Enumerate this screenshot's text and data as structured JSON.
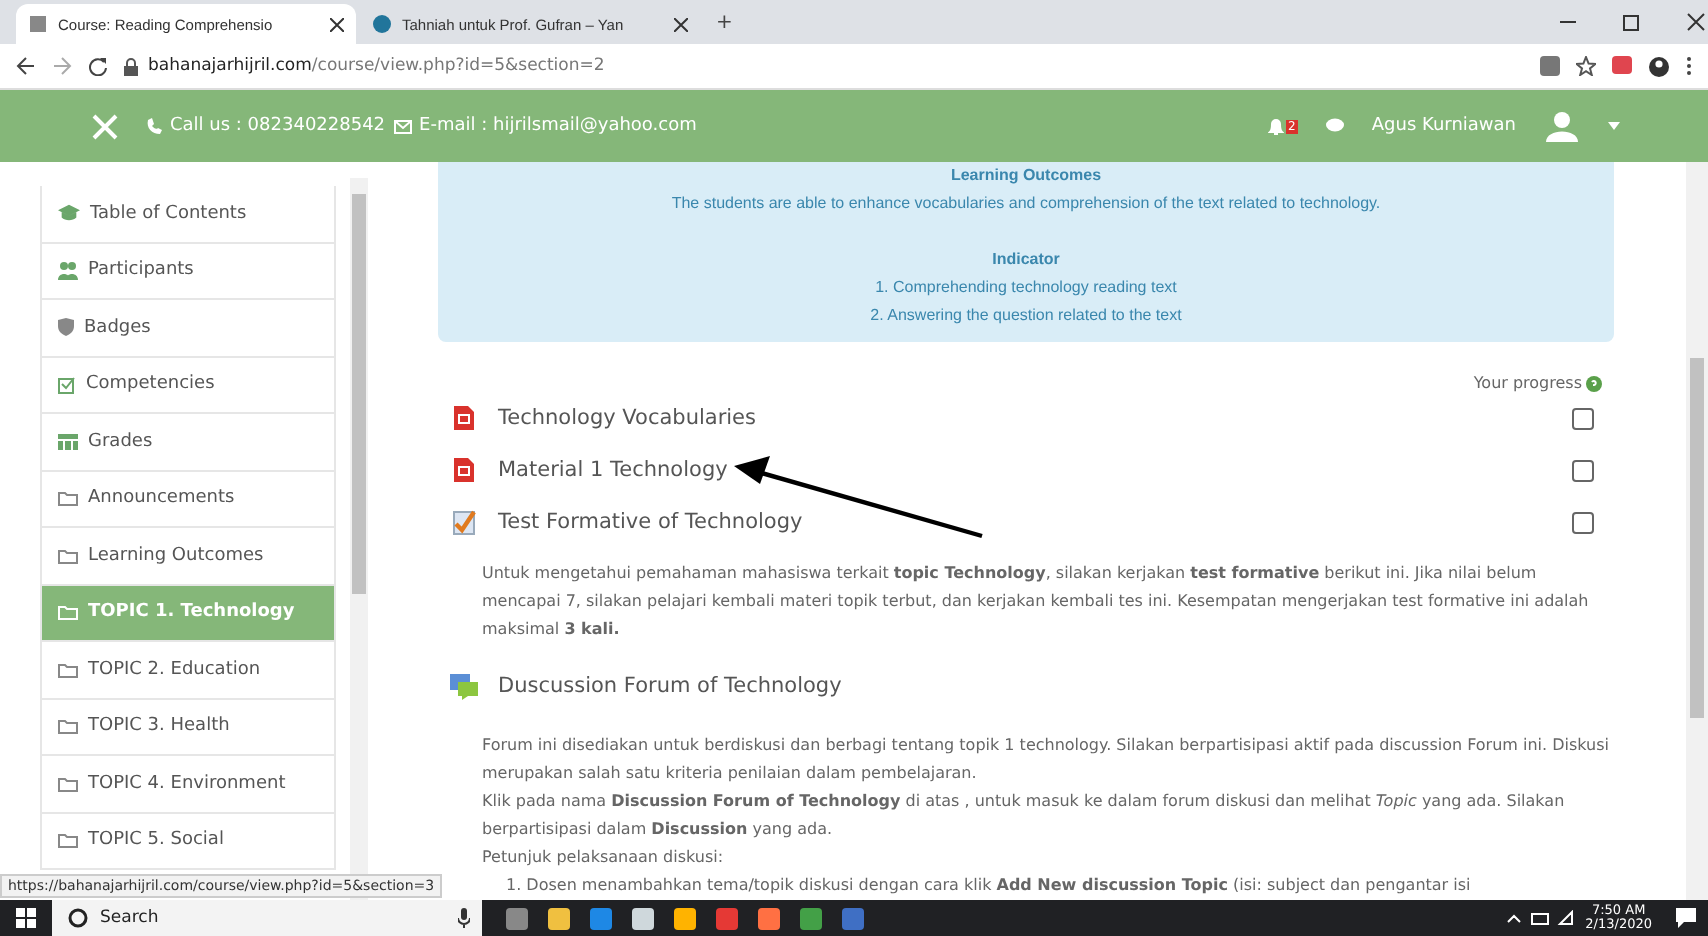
{
  "browser": {
    "tabs": [
      {
        "label": "Course: Reading Comprehensio",
        "selected": true
      },
      {
        "label": "Tahniah untuk Prof. Gufran – Yan",
        "selected": false
      }
    ],
    "new_tab": "+",
    "address": {
      "host": "bahanajarhijril.com",
      "path": "/course/view.php?id=5&section=2"
    }
  },
  "header": {
    "contact": "Call us : 082340228542",
    "email": "E-mail : hijrilsmail@yahoo.com",
    "notification_count": "2",
    "user": "Agus Kurniawan"
  },
  "sidebar": {
    "items": [
      {
        "label": "Table of Contents",
        "kind": "cap",
        "selected": false
      },
      {
        "label": "Participants",
        "kind": "users",
        "selected": false
      },
      {
        "label": "Badges",
        "kind": "shield",
        "selected": false
      },
      {
        "label": "Competencies",
        "kind": "check",
        "selected": false
      },
      {
        "label": "Grades",
        "kind": "table",
        "selected": false
      },
      {
        "label": "Announcements",
        "kind": "folder",
        "selected": false
      },
      {
        "label": "Learning Outcomes",
        "kind": "folder",
        "selected": false
      },
      {
        "label": "TOPIC 1. Technology",
        "kind": "folder",
        "selected": true
      },
      {
        "label": "TOPIC 2. Education",
        "kind": "folder",
        "selected": false
      },
      {
        "label": "TOPIC 3. Health",
        "kind": "folder",
        "selected": false
      },
      {
        "label": "TOPIC 4. Environment",
        "kind": "folder",
        "selected": false
      },
      {
        "label": "TOPIC 5. Social",
        "kind": "folder",
        "selected": false
      }
    ]
  },
  "outcomes": {
    "title": "Learning Outcomes",
    "text": "The students are able to enhance vocabularies and comprehension of the text related to technology.",
    "indicator_title": "Indicator",
    "indicators": [
      "1. Comprehending technology reading text",
      "2. Answering the question related to the text"
    ]
  },
  "progress_label": "Your progress",
  "activities": [
    {
      "kind": "pdf",
      "label": "Technology Vocabularies",
      "checked": false
    },
    {
      "kind": "pdf",
      "label": "Material 1 Technology",
      "checked": false
    },
    {
      "kind": "quiz",
      "label": "Test Formative of Technology",
      "checked": false
    }
  ],
  "quiz_text": "Untuk mengetahui pemahaman mahasiswa terkait **topic Technology**, silakan kerjakan **test formative** berikut ini. Jika nilai belum mencapai 7, silakan pelajari kembali materi topik terbut, dan kerjakan kembali tes ini. Kesempatan mengerjakan test formative ini adalah maksimal  **3 kali.**",
  "forum": {
    "label": "Duscussion Forum of Technology",
    "lines": [
      "Forum ini disediakan untuk berdiskusi dan berbagi tentang topik 1 technology.  Silakan berpartisipasi aktif pada discussion Forum ini. Diskusi merupakan salah satu kriteria penilaian dalam pembelajaran.",
      "Klik pada nama **Discussion Forum of Technology** di atas , untuk masuk ke dalam forum diskusi dan melihat *Topic* yang ada. Silakan berpartisipasi dalam **Discussion** yang ada.",
      "Petunjuk pelaksanaan diskusi:"
    ],
    "steps": [
      "1. Dosen menambahkan tema/topik diskusi dengan cara klik **Add New discussion Topic** (isi: subject dan pengantar isi"
    ]
  },
  "status_url": "https://bahanajarhijril.com/course/view.php?id=5&section=3",
  "taskbar": {
    "search": "Search",
    "time": "7:50 AM",
    "date": "2/13/2020"
  }
}
